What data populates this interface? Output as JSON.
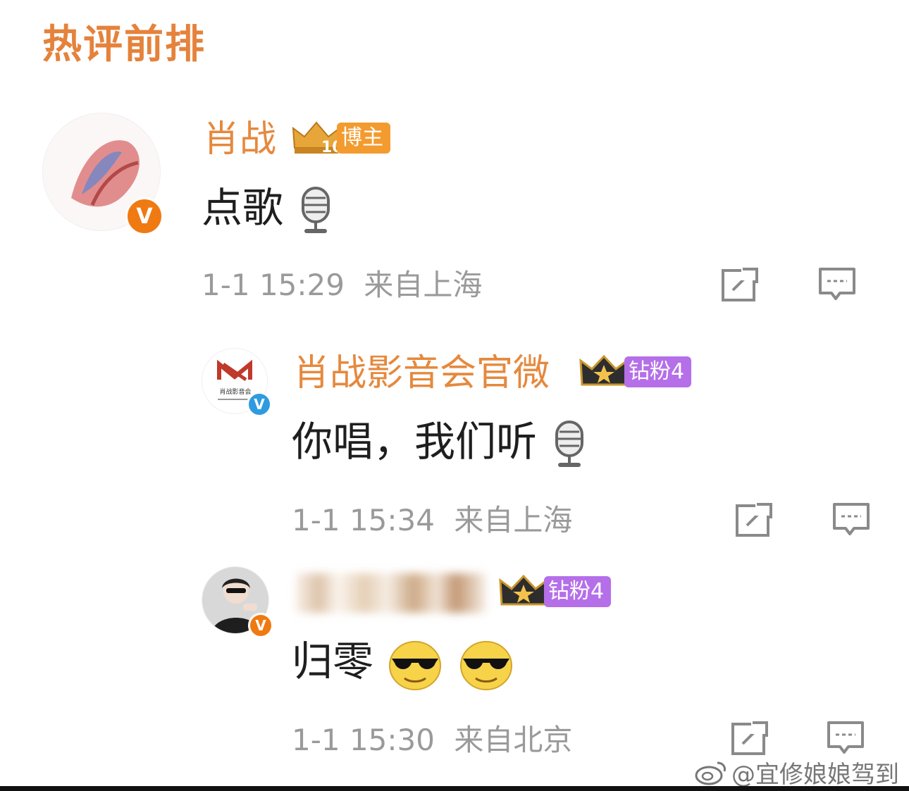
{
  "section": {
    "title": "热评前排"
  },
  "comments": [
    {
      "username": "肖战",
      "badge": {
        "level": "10",
        "label": "博主"
      },
      "text": "点歌",
      "timestamp": "1-1 15:29",
      "location": "来自上海",
      "verified": "orange",
      "emoji": "microphone-icon"
    },
    {
      "username": "肖战影音会官微",
      "badge": {
        "label": "钻粉4"
      },
      "text": "你唱，我们听",
      "timestamp": "1-1 15:34",
      "location": "来自上海",
      "verified": "blue",
      "emoji": "microphone-icon",
      "avatar_text": "肖战影音会"
    },
    {
      "username": "",
      "badge": {
        "label": "钻粉4"
      },
      "text": "归零",
      "timestamp": "1-1 15:30",
      "location": "来自北京",
      "verified": "orange",
      "emoji": "sunglasses-emoji"
    }
  ],
  "watermark": {
    "text": "@宜修娘娘驾到"
  },
  "colors": {
    "username": "#e5893d",
    "gold_badge": "#f39b2e",
    "purple_badge": "#b56fe8",
    "meta": "#9a9a9a"
  }
}
